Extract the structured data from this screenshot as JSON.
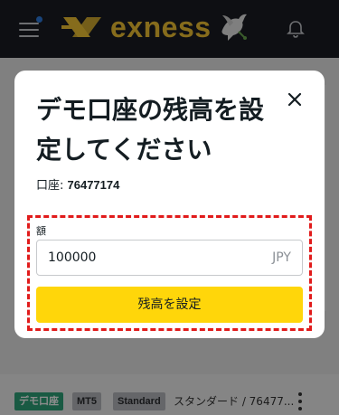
{
  "header": {
    "brand": "exness",
    "menu_icon": "hamburger-icon",
    "notifications_icon": "bell-icon",
    "brand_color": "#f4c534",
    "background_color": "#1a1d23"
  },
  "account_row": {
    "tags": [
      "デモ口座",
      "MT5",
      "Standard"
    ],
    "label": "スタンダード / 76477..."
  },
  "modal": {
    "title": "デモ口座の残高を設定してください",
    "account_prefix": "口座: ",
    "account_number": "76477174",
    "amount_label": "額",
    "amount_value": "100000",
    "currency": "JPY",
    "submit_label": "残高を設定",
    "accent_color": "#ffd60a",
    "highlight_color": "#e11b1b"
  }
}
